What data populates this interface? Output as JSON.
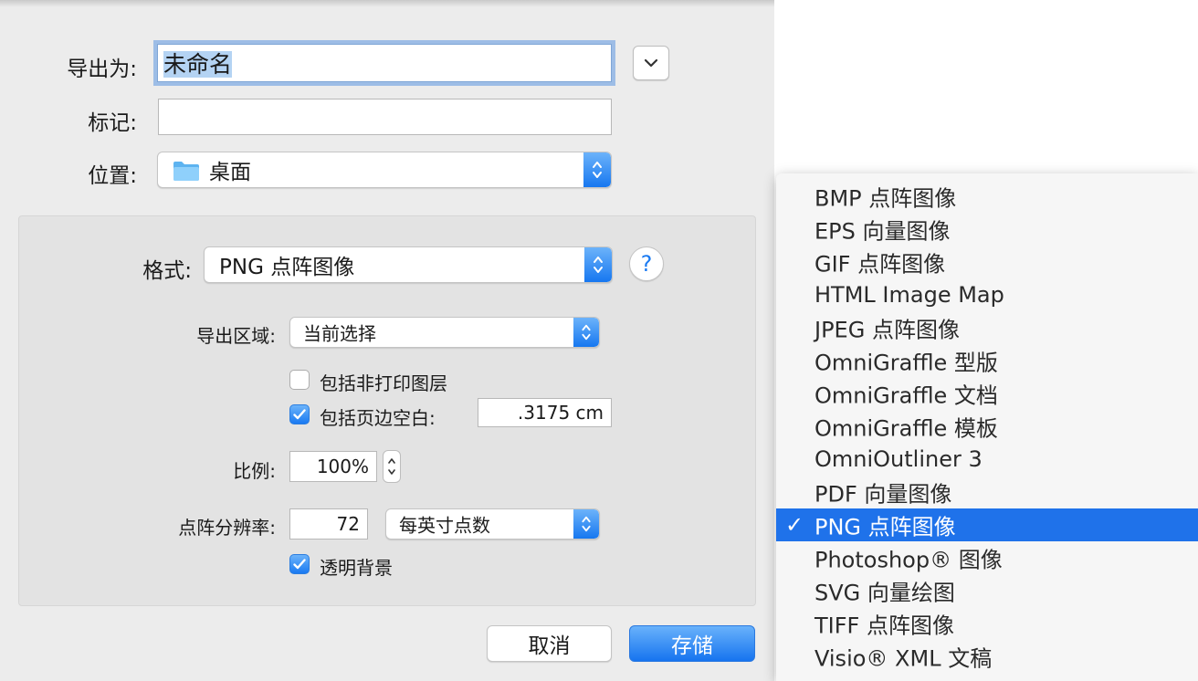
{
  "dialog": {
    "export_as_label": "导出为:",
    "export_as_value": "未命名",
    "tags_label": "标记:",
    "tags_value": "",
    "location_label": "位置:",
    "location_value": "桌面",
    "expand_icon": "chevron-down-icon",
    "folder_icon": "folder-icon"
  },
  "options": {
    "format_label": "格式:",
    "format_value": "PNG 点阵图像",
    "help_label": "?",
    "export_area_label": "导出区域:",
    "export_area_value": "当前选择",
    "include_nonprinting_label": "包括非打印图层",
    "include_nonprinting_checked": false,
    "include_margin_label": "包括页边空白:",
    "include_margin_checked": true,
    "margin_value": ".3175 cm",
    "scale_label": "比例:",
    "scale_value": "100%",
    "resolution_label": "点阵分辨率:",
    "resolution_value": "72",
    "resolution_unit": "每英寸点数",
    "transparent_bg_label": "透明背景",
    "transparent_bg_checked": true
  },
  "buttons": {
    "cancel": "取消",
    "save": "存储"
  },
  "format_menu": {
    "items": [
      "BMP 点阵图像",
      "EPS 向量图像",
      "GIF 点阵图像",
      "HTML Image Map",
      "JPEG 点阵图像",
      "OmniGraffle 型版",
      "OmniGraffle 文档",
      "OmniGraffle 模板",
      "OmniOutliner 3",
      "PDF 向量图像",
      "PNG 点阵图像",
      "Photoshop® 图像",
      "SVG 向量绘图",
      "TIFF 点阵图像",
      "Visio® XML 文稿"
    ],
    "selected_index": 10,
    "check_mark": "✓"
  },
  "colors": {
    "accent": "#1f72ea",
    "dialog_bg": "#ececec",
    "panel_bg": "#e3e3e3"
  }
}
